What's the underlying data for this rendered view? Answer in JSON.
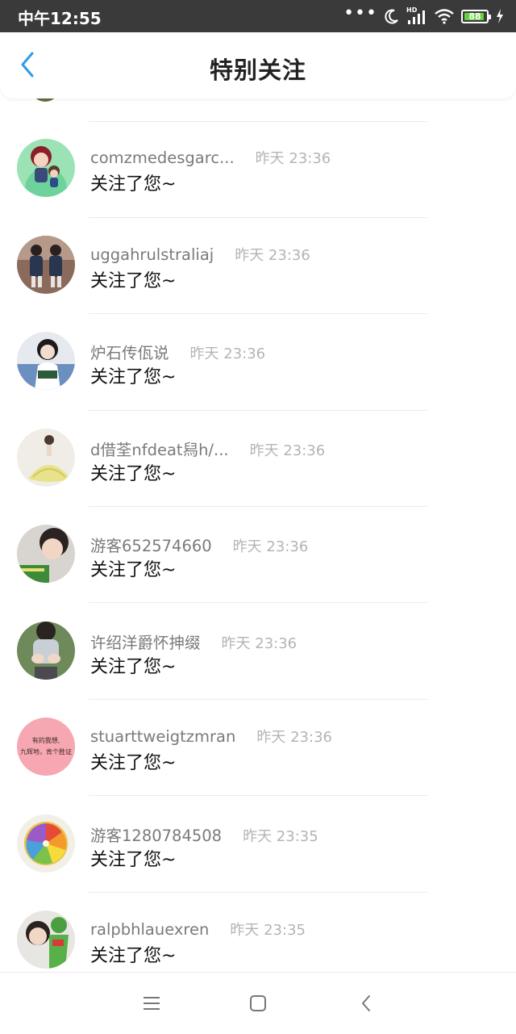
{
  "status_bar": {
    "time": "中午12:55",
    "battery": "88",
    "network": "HD"
  },
  "header": {
    "title": "特别关注",
    "back_icon": "chevron-left-icon"
  },
  "colors": {
    "accent": "#2a9de8",
    "status_bar_bg": "#3a3a3a",
    "battery_fill": "#64d13e"
  },
  "items": [
    {
      "username": "comzmedesgarc...",
      "time": "昨天 23:36",
      "action": "关注了您~",
      "avatar": "cartoon-couple-avatar"
    },
    {
      "username": "uggahrulstraliaj",
      "time": "昨天 23:36",
      "action": "关注了您~",
      "avatar": "two-kids-avatar"
    },
    {
      "username": "炉石传佤说",
      "time": "昨天 23:36",
      "action": "关注了您~",
      "avatar": "girl-photo-avatar"
    },
    {
      "username": "d借荃nfdeat舄h/...",
      "time": "昨天 23:36",
      "action": "关注了您~",
      "avatar": "yellow-dress-avatar"
    },
    {
      "username": "游客652574660",
      "time": "昨天 23:36",
      "action": "关注了您~",
      "avatar": "boy-photo-avatar"
    },
    {
      "username": "许绍洋爵怀抻缀",
      "time": "昨天 23:36",
      "action": "关注了您~",
      "avatar": "hands-avatar"
    },
    {
      "username": "stuarttweigtzmran",
      "time": "昨天 23:36",
      "action": "关注了您~",
      "avatar": "pink-text-avatar",
      "avatar_text_1": "有的我想,",
      "avatar_text_2": "九辉地，肯个胜证"
    },
    {
      "username": "游客1280784508",
      "time": "昨天 23:35",
      "action": "关注了您~",
      "avatar": "citrus-slice-avatar"
    },
    {
      "username": "ralpbhlauexren",
      "time": "昨天 23:35",
      "action": "关注了您~",
      "avatar": "frog-toy-avatar"
    }
  ],
  "nav": {
    "menu_icon": "menu-icon",
    "home_icon": "home-square-icon",
    "back_icon": "back-chevron-icon"
  }
}
